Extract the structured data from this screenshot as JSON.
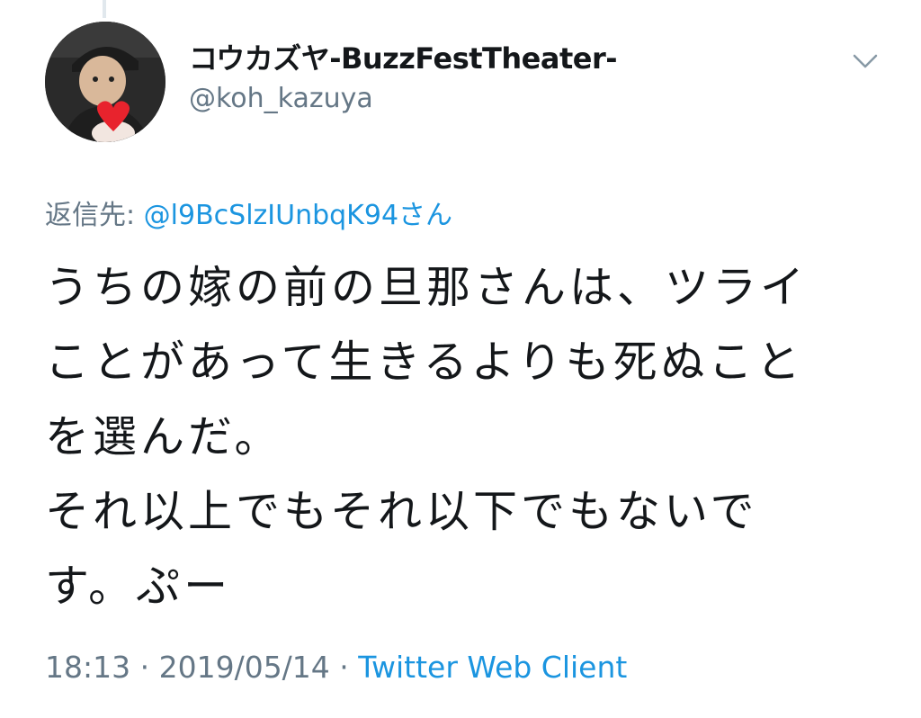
{
  "tweet": {
    "display_name": "コウカズヤ-BuzzFestTheater-",
    "handle": "@koh_kazuya",
    "reply_prefix": "返信先: ",
    "reply_to": "@l9BcSlzIUnbqK94さん",
    "body": "うちの嫁の前の旦那さんは、ツライ\nことがあって生きるよりも死ぬこと\nを選んだ。\nそれ以上でもそれ以下でもないで\nす。ぷー",
    "time": "18:13",
    "separator": " · ",
    "date": "2019/05/14",
    "source": "Twitter Web Client"
  },
  "icons": {
    "menu": "chevron-down-icon",
    "avatar": "profile-photo"
  },
  "colors": {
    "text": "#14171a",
    "secondary": "#657786",
    "link": "#1b95e0"
  }
}
